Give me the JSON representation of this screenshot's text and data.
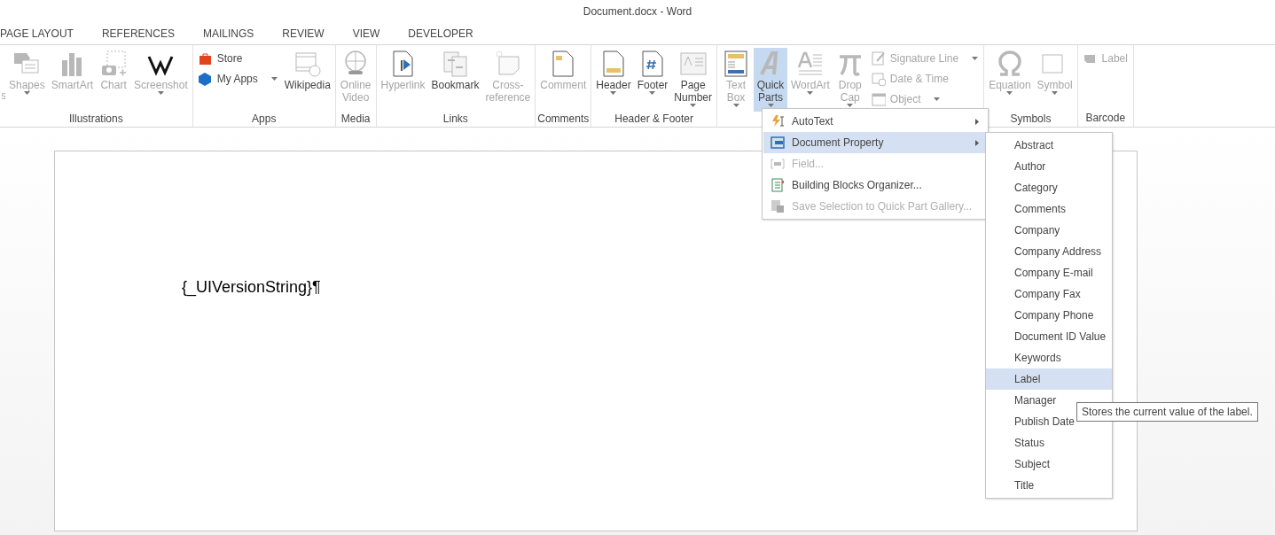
{
  "window": {
    "title": "Document.docx - Word"
  },
  "tabs": [
    {
      "label": "PAGE LAYOUT",
      "selected": false
    },
    {
      "label": "REFERENCES",
      "selected": false
    },
    {
      "label": "MAILINGS",
      "selected": false
    },
    {
      "label": "REVIEW",
      "selected": false
    },
    {
      "label": "VIEW",
      "selected": false
    },
    {
      "label": "DEVELOPER",
      "selected": false
    }
  ],
  "ribbon": {
    "groups": [
      {
        "label": "Illustrations",
        "items": [
          {
            "kind": "partial",
            "label": "s",
            "disabled": true,
            "caret": false,
            "selected": false
          },
          {
            "kind": "large",
            "label": "Shapes",
            "disabled": true,
            "caret": true,
            "selected": false
          },
          {
            "kind": "large",
            "label": "SmartArt",
            "disabled": true,
            "caret": false,
            "selected": false
          },
          {
            "kind": "large",
            "label": "Chart",
            "disabled": true,
            "caret": false,
            "selected": false
          },
          {
            "kind": "large",
            "label": "Screenshot",
            "disabled": true,
            "caret": true,
            "selected": false
          }
        ]
      },
      {
        "label": "Apps",
        "items": [
          {
            "kind": "stack",
            "items": [
              {
                "label": "Store",
                "disabled": false,
                "caret": false
              },
              {
                "label": "My Apps",
                "disabled": false,
                "caret": true
              }
            ]
          },
          {
            "kind": "large",
            "label": "Wikipedia",
            "disabled": false,
            "caret": false,
            "selected": false
          }
        ]
      },
      {
        "label": "Media",
        "items": [
          {
            "kind": "large",
            "label": "Online\nVideo",
            "disabled": true,
            "caret": false,
            "selected": false
          }
        ]
      },
      {
        "label": "Links",
        "items": [
          {
            "kind": "large",
            "label": "Hyperlink",
            "disabled": true,
            "caret": false,
            "selected": false
          },
          {
            "kind": "large",
            "label": "Bookmark",
            "disabled": false,
            "caret": false,
            "selected": false
          },
          {
            "kind": "large",
            "label": "Cross-\nreference",
            "disabled": true,
            "caret": false,
            "selected": false
          }
        ]
      },
      {
        "label": "Comments",
        "items": [
          {
            "kind": "large",
            "label": "Comment",
            "disabled": true,
            "caret": false,
            "selected": false
          }
        ]
      },
      {
        "label": "Header & Footer",
        "items": [
          {
            "kind": "large",
            "label": "Header",
            "disabled": false,
            "caret": true,
            "selected": false
          },
          {
            "kind": "large",
            "label": "Footer",
            "disabled": false,
            "caret": true,
            "selected": false
          },
          {
            "kind": "large",
            "label": "Page\nNumber",
            "disabled": false,
            "caret": true,
            "selected": false
          }
        ]
      },
      {
        "items": [
          {
            "kind": "large",
            "label": "Text\nBox",
            "disabled": true,
            "caret": true,
            "selected": false
          },
          {
            "kind": "large",
            "label": "Quick\nParts",
            "disabled": false,
            "caret": true,
            "selected": true
          },
          {
            "kind": "large",
            "label": "WordArt",
            "disabled": true,
            "caret": true,
            "selected": false
          },
          {
            "kind": "large",
            "label": "Drop\nCap",
            "disabled": true,
            "caret": true,
            "selected": false
          },
          {
            "kind": "stack",
            "items": [
              {
                "label": "Signature Line",
                "disabled": true,
                "caret": true
              },
              {
                "label": "Date & Time",
                "disabled": true,
                "caret": false
              },
              {
                "label": "Object",
                "disabled": true,
                "caret": true
              }
            ]
          }
        ]
      },
      {
        "label": "Symbols",
        "items": [
          {
            "kind": "large",
            "label": "Equation",
            "disabled": true,
            "caret": true,
            "selected": false
          },
          {
            "kind": "large",
            "label": "Symbol",
            "disabled": true,
            "caret": true,
            "selected": false
          }
        ]
      },
      {
        "label": "Barcode",
        "items": [
          {
            "kind": "stack",
            "items": [
              {
                "label": "Label",
                "disabled": true,
                "caret": false
              }
            ]
          }
        ]
      }
    ]
  },
  "document": {
    "text": "{_UIVersionString}¶"
  },
  "quick_parts_menu": {
    "items": [
      {
        "label": "AutoText",
        "disabled": false,
        "selected": false,
        "submenu": true
      },
      {
        "label": "Document Property",
        "disabled": false,
        "selected": true,
        "submenu": true
      },
      {
        "label": "Field...",
        "disabled": true,
        "selected": false,
        "submenu": false
      },
      {
        "label": "Building Blocks Organizer...",
        "disabled": false,
        "selected": false,
        "submenu": false
      },
      {
        "label": "Save Selection to Quick Part Gallery...",
        "disabled": true,
        "selected": false,
        "submenu": false
      }
    ]
  },
  "property_submenu": {
    "items": [
      {
        "label": "Abstract",
        "selected": false
      },
      {
        "label": "Author",
        "selected": false
      },
      {
        "label": "Category",
        "selected": false
      },
      {
        "label": "Comments",
        "selected": false
      },
      {
        "label": "Company",
        "selected": false
      },
      {
        "label": "Company Address",
        "selected": false
      },
      {
        "label": "Company E-mail",
        "selected": false
      },
      {
        "label": "Company Fax",
        "selected": false
      },
      {
        "label": "Company Phone",
        "selected": false
      },
      {
        "label": "Document ID Value",
        "selected": false
      },
      {
        "label": "Keywords",
        "selected": false
      },
      {
        "label": "Label",
        "selected": true
      },
      {
        "label": "Manager",
        "selected": false
      },
      {
        "label": "Publish Date",
        "selected": false
      },
      {
        "label": "Status",
        "selected": false
      },
      {
        "label": "Subject",
        "selected": false
      },
      {
        "label": "Title",
        "selected": false
      }
    ]
  },
  "tooltip": {
    "text": "Stores the current value of the label."
  }
}
